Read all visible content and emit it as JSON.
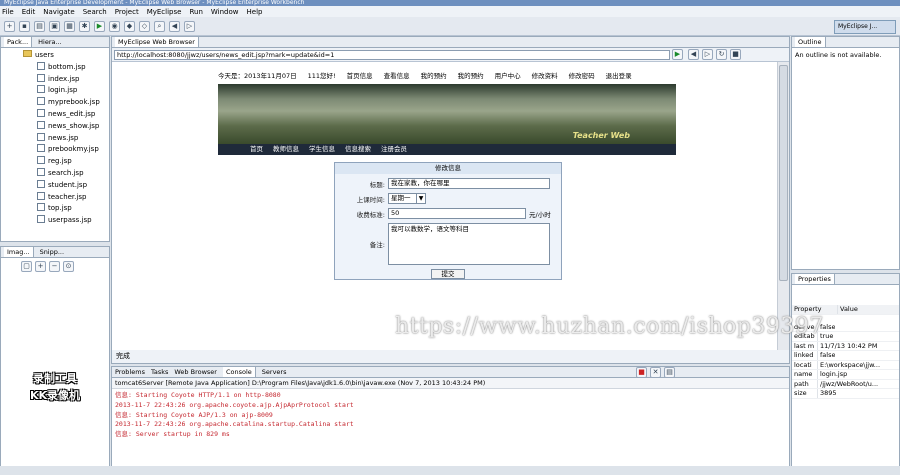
{
  "window": {
    "title": "MyEclipse Java Enterprise Development - MyEclipse Web Browser - MyEclipse Enterprise Workbench"
  },
  "menu": [
    "File",
    "Edit",
    "Navigate",
    "Search",
    "Project",
    "MyEclipse",
    "Run",
    "Window",
    "Help"
  ],
  "perspective": {
    "label": "MyEclipse J..."
  },
  "package_view": {
    "tabs": [
      "Pack...",
      "Hiera..."
    ],
    "folder": "users",
    "files": [
      "bottom.jsp",
      "index.jsp",
      "login.jsp",
      "myprebook.jsp",
      "news_edit.jsp",
      "news_show.jsp",
      "news.jsp",
      "prebookmy.jsp",
      "reg.jsp",
      "search.jsp",
      "student.jsp",
      "teacher.jsp",
      "top.jsp",
      "userpass.jsp"
    ]
  },
  "image_view": {
    "tabs": [
      "Imag...",
      "Snipp..."
    ]
  },
  "browser": {
    "tab": "MyEclipse Web Browser",
    "url": "http://localhost:8080/jjwz/users/news_edit.jsp?mark=update&id=1",
    "status": "完成",
    "page": {
      "date_text": "今天是：2013年11月07日",
      "welcome": "111您好!",
      "top_links": [
        "首页信息",
        "查看信息",
        "我的预约",
        "我的预约",
        "用户中心",
        "修改资料",
        "修改密码",
        "退出登录"
      ],
      "banner_text": "Teacher Web",
      "nav_links": [
        "首页",
        "教师信息",
        "学生信息",
        "信息搜索",
        "注册会员"
      ],
      "form": {
        "title": "修改信息",
        "fields": [
          {
            "label": "标题:",
            "value": "我在家教，你在哪里"
          },
          {
            "label": "上课时间:",
            "value": "星期一"
          },
          {
            "label": "收费标准:",
            "value": "50",
            "unit": "元/小时"
          },
          {
            "label": "备注:",
            "value": "我可以教数学，语文等科目"
          }
        ],
        "submit": "提交"
      }
    }
  },
  "outline": {
    "tab": "Outline",
    "message": "An outline is not available."
  },
  "properties": {
    "tab": "Properties",
    "header": {
      "key": "Property",
      "value": "Value"
    },
    "rows": [
      {
        "k": "derive",
        "v": "false"
      },
      {
        "k": "editab",
        "v": "true"
      },
      {
        "k": "last m",
        "v": "11/7/13 10:42 PM"
      },
      {
        "k": "linked",
        "v": "false"
      },
      {
        "k": "locati",
        "v": "E:\\workspace\\jjw..."
      },
      {
        "k": "name",
        "v": "login.jsp"
      },
      {
        "k": "path",
        "v": "/jjwz/WebRoot/u..."
      },
      {
        "k": "size",
        "v": "3895"
      }
    ]
  },
  "console": {
    "tabs": [
      "Problems",
      "Tasks",
      "Web Browser",
      "Console",
      "Servers"
    ],
    "header": "tomcat6Server [Remote Java Application] D:\\Program Files\\Java\\jdk1.6.0\\bin\\javaw.exe (Nov 7, 2013 10:43:24 PM)",
    "lines": [
      "信息: Starting Coyote HTTP/1.1 on http-8080",
      "2013-11-7 22:43:26 org.apache.coyote.ajp.AjpAprProtocol start",
      "信息: Starting Coyote AJP/1.3 on ajp-8009",
      "2013-11-7 22:43:26 org.apache.catalina.startup.Catalina start",
      "信息: Server startup in 829 ms"
    ]
  },
  "watermark": "https://www.huzhan.com/ishop39397",
  "recorder": {
    "line1": "录制工具",
    "line2": "KK录像机"
  }
}
